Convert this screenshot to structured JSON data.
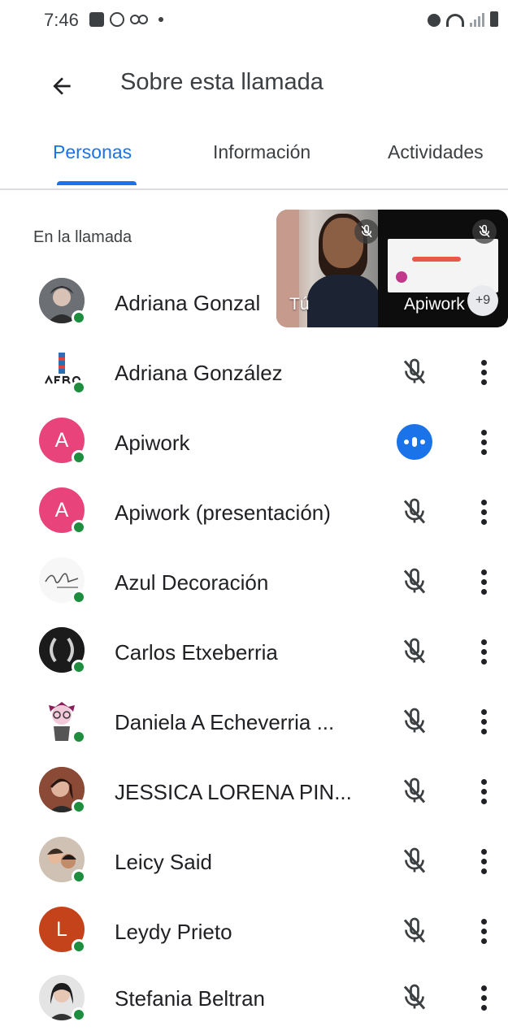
{
  "status_bar": {
    "time": "7:46",
    "left_icons": [
      "gallery-icon",
      "whatsapp-icon",
      "voicemail-icon",
      "dot-icon"
    ],
    "right_icons": [
      "alarm-icon",
      "wifi-icon",
      "signal-icon",
      "battery-icon"
    ]
  },
  "app_bar": {
    "title": "Sobre esta llamada"
  },
  "tabs": [
    {
      "label": "Personas",
      "active": true
    },
    {
      "label": "Información",
      "active": false
    },
    {
      "label": "Actividades",
      "active": false
    }
  ],
  "section": {
    "title": "En la llamada"
  },
  "pip": {
    "self_label": "Tú",
    "other_label": "Apiwork",
    "more_count": "+9"
  },
  "participants": [
    {
      "name": "Adriana Gonzal",
      "avatar": "photo",
      "initial": "",
      "mic": "hidden"
    },
    {
      "name": "Adriana González",
      "avatar": "logo",
      "initial": "",
      "mic": "muted"
    },
    {
      "name": "Apiwork",
      "avatar": "letter",
      "initial": "A",
      "mic": "speaking"
    },
    {
      "name": "Apiwork (presentación)",
      "avatar": "letter",
      "initial": "A",
      "mic": "muted"
    },
    {
      "name": "Azul Decoración",
      "avatar": "logo",
      "initial": "",
      "mic": "muted"
    },
    {
      "name": "Carlos Etxeberria",
      "avatar": "photo",
      "initial": "",
      "mic": "muted"
    },
    {
      "name": "Daniela A Echeverria ...",
      "avatar": "photo",
      "initial": "",
      "mic": "muted"
    },
    {
      "name": "JESSICA LORENA PIN...",
      "avatar": "photo",
      "initial": "",
      "mic": "muted"
    },
    {
      "name": "Leicy Said",
      "avatar": "photo",
      "initial": "",
      "mic": "muted"
    },
    {
      "name": "Leydy Prieto",
      "avatar": "letter",
      "initial": "L",
      "mic": "muted"
    },
    {
      "name": "Stefania Beltran",
      "avatar": "photo",
      "initial": "",
      "mic": "muted"
    }
  ],
  "colors": {
    "accent": "#1a73e8",
    "presence": "#1e8e3e",
    "avatar_pink": "#e8437a",
    "avatar_brown": "#c5431b"
  }
}
